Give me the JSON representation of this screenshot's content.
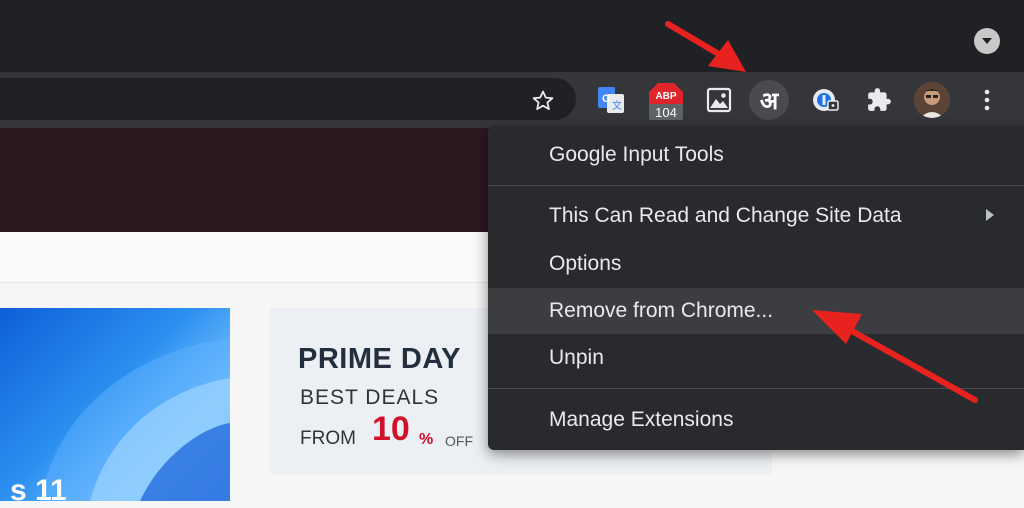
{
  "toolbar": {
    "extensions": [
      {
        "name": "google-translate-icon"
      },
      {
        "name": "abp-icon",
        "badge": "104",
        "label": "ABP"
      },
      {
        "name": "image-icon"
      },
      {
        "name": "google-input-tools-icon",
        "glyph": "अ"
      },
      {
        "name": "password-manager-icon"
      },
      {
        "name": "puzzle-extensions-icon"
      },
      {
        "name": "profile-avatar"
      },
      {
        "name": "more-menu-icon"
      }
    ]
  },
  "context_menu": {
    "header": "Google Input Tools",
    "items": [
      {
        "label": "This Can Read and Change Site Data"
      },
      {
        "label": "Options"
      },
      {
        "label": "Remove from Chrome..."
      },
      {
        "label": "Unpin"
      }
    ],
    "footer": "Manage Extensions"
  },
  "page": {
    "left_card_text": "s 11",
    "promo": {
      "title": "PRIME DAY",
      "subtitle": "BEST DEALS",
      "from": "FROM",
      "percent": "10",
      "percent_sign": "%",
      "off": "OFF"
    }
  },
  "colors": {
    "annotation_arrow": "#e8231f",
    "menu_bg": "#292a2d",
    "toolbar_bg": "#35363a"
  }
}
